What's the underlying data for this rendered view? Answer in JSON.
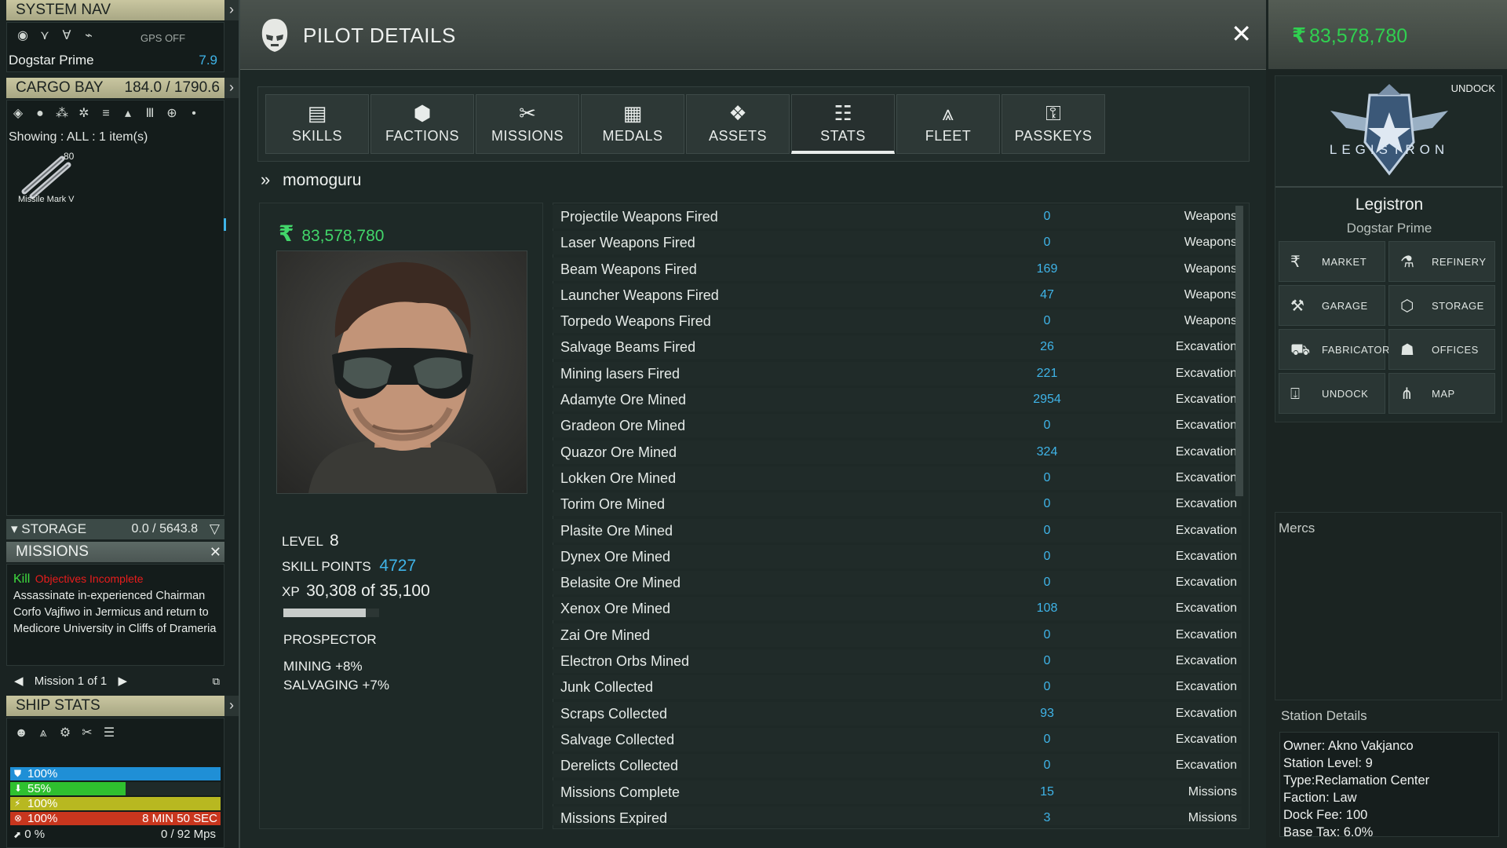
{
  "system_nav": {
    "title": "SYSTEM NAV",
    "gps": "GPS OFF",
    "location": "Dogstar Prime",
    "location_value": "7.9"
  },
  "cargo_bay": {
    "title": "CARGO BAY",
    "capacity": "184.0 / 1790.6",
    "showing": "Showing : ALL : 1 item(s)",
    "item_name": "Missile Mark V",
    "item_count": "80"
  },
  "storage": {
    "title": "STORAGE",
    "capacity": "0.0 / 5643.8"
  },
  "missions": {
    "title": "MISSIONS",
    "type": "Kill",
    "status": "Objectives Incomplete",
    "description": "Assassinate in-experienced Chairman Corfo Vajfiwo in Jermicus and return to Medicore University in Cliffs of Drameria",
    "pager": "Mission 1 of 1"
  },
  "ship_stats": {
    "title": "SHIP STATS",
    "bars": [
      {
        "label": "100%",
        "fill": 1.0,
        "color": "#1f8fd6"
      },
      {
        "label": "55%",
        "fill": 0.55,
        "color": "#2fc02f"
      },
      {
        "label": "100%",
        "fill": 1.0,
        "color": "#b8b820"
      },
      {
        "label": "100%",
        "fill": 1.0,
        "color": "#c8361e",
        "extra": "8 MIN 50 SEC"
      }
    ],
    "speed_pct": "0 %",
    "speed": "0  /  92 Mps"
  },
  "pilot": {
    "window_title": "PILOT DETAILS",
    "tabs": [
      "SKILLS",
      "FACTIONS",
      "MISSIONS",
      "MEDALS",
      "ASSETS",
      "STATS",
      "FLEET",
      "PASSKEYS"
    ],
    "active_tab": "STATS",
    "name": "momoguru",
    "credits": "83,578,780",
    "level_label": "LEVEL",
    "level": "8",
    "skill_points_label": "SKILL POINTS",
    "skill_points": "4727",
    "xp_label": "XP",
    "xp": "30,308 of 35,100",
    "xp_fraction": 0.863,
    "class": "PROSPECTOR",
    "bonus1": "MINING +8%",
    "bonus2": "SALVAGING +7%"
  },
  "stats": [
    {
      "name": "Projectile Weapons Fired",
      "value": "0",
      "category": "Weapons"
    },
    {
      "name": "Laser Weapons Fired",
      "value": "0",
      "category": "Weapons"
    },
    {
      "name": "Beam Weapons Fired",
      "value": "169",
      "category": "Weapons"
    },
    {
      "name": "Launcher Weapons Fired",
      "value": "47",
      "category": "Weapons"
    },
    {
      "name": "Torpedo Weapons Fired",
      "value": "0",
      "category": "Weapons"
    },
    {
      "name": "Salvage Beams Fired",
      "value": "26",
      "category": "Excavation"
    },
    {
      "name": "Mining lasers Fired",
      "value": "221",
      "category": "Excavation"
    },
    {
      "name": "Adamyte Ore Mined",
      "value": "2954",
      "category": "Excavation"
    },
    {
      "name": "Gradeon Ore Mined",
      "value": "0",
      "category": "Excavation"
    },
    {
      "name": "Quazor Ore Mined",
      "value": "324",
      "category": "Excavation"
    },
    {
      "name": "Lokken Ore Mined",
      "value": "0",
      "category": "Excavation"
    },
    {
      "name": "Torim Ore Mined",
      "value": "0",
      "category": "Excavation"
    },
    {
      "name": "Plasite Ore Mined",
      "value": "0",
      "category": "Excavation"
    },
    {
      "name": "Dynex Ore Mined",
      "value": "0",
      "category": "Excavation"
    },
    {
      "name": "Belasite Ore Mined",
      "value": "0",
      "category": "Excavation"
    },
    {
      "name": "Xenox Ore Mined",
      "value": "108",
      "category": "Excavation"
    },
    {
      "name": "Zai Ore Mined",
      "value": "0",
      "category": "Excavation"
    },
    {
      "name": "Electron Orbs Mined",
      "value": "0",
      "category": "Excavation"
    },
    {
      "name": "Junk Collected",
      "value": "0",
      "category": "Excavation"
    },
    {
      "name": "Scraps Collected",
      "value": "93",
      "category": "Excavation"
    },
    {
      "name": "Salvage Collected",
      "value": "0",
      "category": "Excavation"
    },
    {
      "name": "Derelicts Collected",
      "value": "0",
      "category": "Excavation"
    },
    {
      "name": "Missions Complete",
      "value": "15",
      "category": "Missions"
    },
    {
      "name": "Missions Expired",
      "value": "3",
      "category": "Missions"
    }
  ],
  "station": {
    "credits": "83,578,780",
    "undock_corner": "UNDOCK",
    "logo_text": "LEGISTRON",
    "name": "Legistron",
    "system": "Dogstar Prime",
    "buttons": [
      "MARKET",
      "REFINERY",
      "GARAGE",
      "STORAGE",
      "FABRICATOR",
      "OFFICES",
      "UNDOCK",
      "MAP"
    ],
    "mercs_label": "Mercs",
    "details_label": "Station Details",
    "details": [
      "Owner: Akno Vakjanco",
      "Station Level: 9",
      "Type:Reclamation Center",
      "Faction: Law",
      "Dock Fee: 100",
      "Base Tax: 6.0%"
    ]
  }
}
